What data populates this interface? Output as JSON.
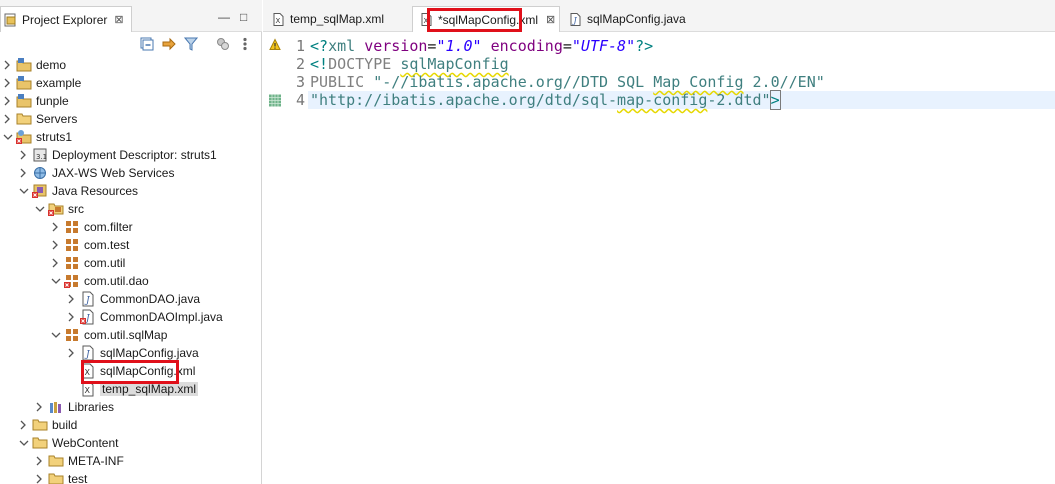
{
  "explorer": {
    "title": "Project Explorer",
    "close_glyph": "⊠",
    "minimize_glyph": "—",
    "maximize_glyph": "□",
    "toolbar_icons": [
      "collapse-all-icon",
      "link-with-editor-icon",
      "filter-icon",
      "focus-icon",
      "view-menu-icon"
    ],
    "tree": [
      {
        "label": "demo",
        "icon": "project-folder-icon",
        "expanded": false
      },
      {
        "label": "example",
        "icon": "project-folder-icon",
        "expanded": false
      },
      {
        "label": "funple",
        "icon": "project-folder-icon",
        "expanded": false
      },
      {
        "label": "Servers",
        "icon": "folder-icon",
        "expanded": false
      },
      {
        "label": "struts1",
        "icon": "web-project-error-icon",
        "expanded": true
      },
      {
        "label": "Deployment Descriptor: struts1",
        "icon": "deployment-descriptor-icon",
        "expanded": false
      },
      {
        "label": "JAX-WS Web Services",
        "icon": "web-services-icon",
        "expanded": false
      },
      {
        "label": "Java Resources",
        "icon": "java-resources-error-icon",
        "expanded": true
      },
      {
        "label": "src",
        "icon": "source-folder-error-icon",
        "expanded": true
      },
      {
        "label": "com.filter",
        "icon": "package-icon",
        "expanded": false
      },
      {
        "label": "com.test",
        "icon": "package-icon",
        "expanded": false
      },
      {
        "label": "com.util",
        "icon": "package-icon",
        "expanded": false
      },
      {
        "label": "com.util.dao",
        "icon": "package-error-icon",
        "expanded": true
      },
      {
        "label": "CommonDAO.java",
        "icon": "java-file-icon",
        "expanded": false
      },
      {
        "label": "CommonDAOImpl.java",
        "icon": "java-file-error-icon",
        "expanded": false
      },
      {
        "label": "com.util.sqlMap",
        "icon": "package-icon",
        "expanded": true
      },
      {
        "label": "sqlMapConfig.java",
        "icon": "java-file-icon",
        "expanded": false
      },
      {
        "label": "sqlMapConfig.xml",
        "icon": "xml-file-icon",
        "expanded": null
      },
      {
        "label": "temp_sqlMap.xml",
        "icon": "xml-file-icon",
        "expanded": null
      },
      {
        "label": "Libraries",
        "icon": "libraries-icon",
        "expanded": false
      },
      {
        "label": "build",
        "icon": "folder-icon",
        "expanded": false
      },
      {
        "label": "WebContent",
        "icon": "folder-icon",
        "expanded": true
      },
      {
        "label": "META-INF",
        "icon": "folder-icon",
        "expanded": false
      },
      {
        "label": "test",
        "icon": "folder-icon",
        "expanded": false
      }
    ]
  },
  "editor": {
    "tabs": [
      {
        "label": "temp_sqlMap.xml",
        "icon": "xml-file-icon",
        "active": false
      },
      {
        "label": "*sqlMapConfig.xml",
        "icon": "xml-file-icon",
        "active": true,
        "close_glyph": "⊠"
      },
      {
        "label": "sqlMapConfig.java",
        "icon": "java-file-icon",
        "active": false
      }
    ],
    "line_numbers": [
      "1",
      "2",
      "3",
      "4"
    ],
    "code": {
      "l1_open": "<?",
      "l1_xml": "xml",
      "l1_sp1": " ",
      "l1_version": "version",
      "l1_eq1": "=",
      "l1_vval": "\"1.0\"",
      "l1_sp2": " ",
      "l1_encoding": "encoding",
      "l1_eq2": "=",
      "l1_eval": "\"UTF-8\"",
      "l1_close": "?>",
      "l2_open": "<!",
      "l2_doctype": "DOCTYPE",
      "l2_sp": " ",
      "l2_name": "sqlMapConfig",
      "l3_public": "PUBLIC",
      "l3_sp": " ",
      "l3_id_a": "\"-//ibatis.apache.org//DTD SQL ",
      "l3_id_b": "Map Config",
      "l3_id_c": " 2.0//EN\"",
      "l4_url_a": "\"http://ibatis.apache.org/dtd/sql-",
      "l4_url_b": "map-config",
      "l4_url_c": "-2.dtd\"",
      "l4_close": ">"
    }
  },
  "colors": {
    "highlight_box": "#e0101a",
    "squiggle": "#e6d800",
    "current_line": "#e8f2fe"
  }
}
